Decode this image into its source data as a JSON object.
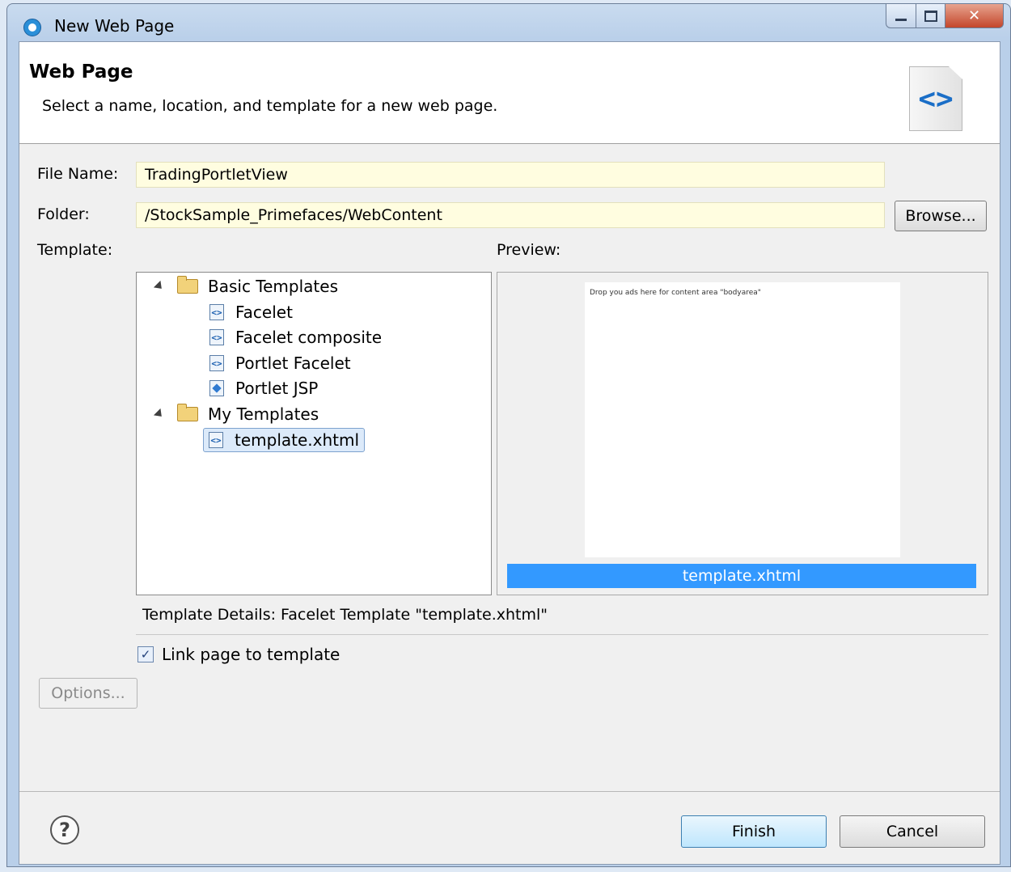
{
  "window": {
    "title": "New Web Page"
  },
  "header": {
    "title": "Web Page",
    "subtitle": "Select a name, location, and template for a new web page."
  },
  "form": {
    "file_name_label": "File Name:",
    "file_name_value": "TradingPortletView",
    "folder_label": "Folder:",
    "folder_value": "/StockSample_Primefaces/WebContent",
    "browse_label": "Browse...",
    "template_label": "Template:",
    "preview_label": "Preview:"
  },
  "tree": {
    "groups": [
      {
        "label": "Basic Templates",
        "items": [
          "Facelet",
          "Facelet composite",
          "Portlet Facelet",
          "Portlet JSP"
        ]
      },
      {
        "label": "My Templates",
        "items": [
          "template.xhtml"
        ]
      }
    ],
    "selected": "template.xhtml"
  },
  "preview": {
    "page_text": "Drop you ads here for content area \"bodyarea\"",
    "caption": "template.xhtml"
  },
  "details": "Template Details:  Facelet Template \"template.xhtml\"",
  "link_template": {
    "label": "Link page to template",
    "checked": true
  },
  "buttons": {
    "options": "Options...",
    "finish": "Finish",
    "cancel": "Cancel"
  }
}
